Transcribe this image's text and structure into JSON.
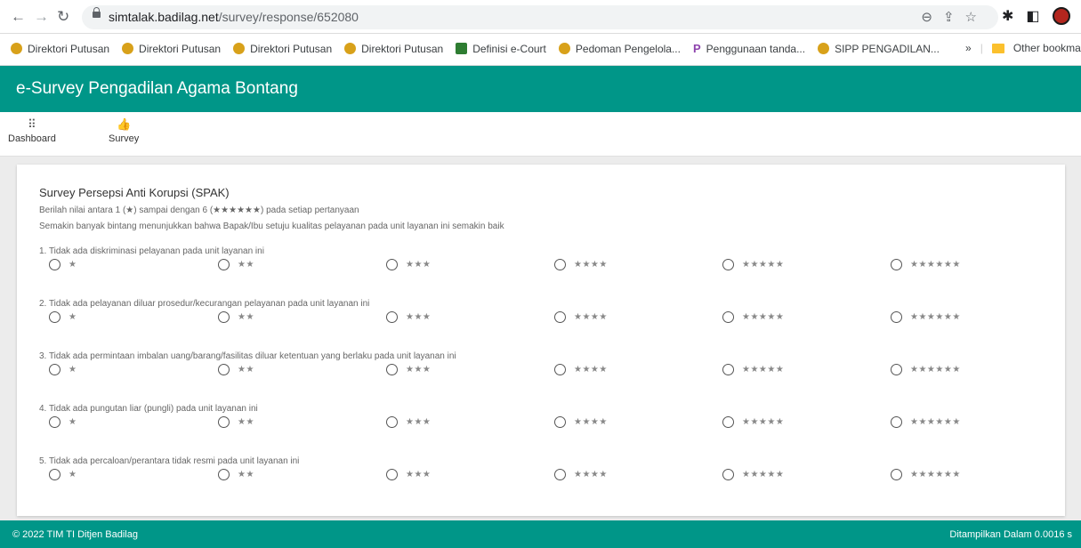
{
  "browser": {
    "url_host": "simtalak.badilag.net",
    "url_path": "/survey/response/652080",
    "bookmarks": [
      {
        "label": "Direktori Putusan",
        "icon": "coin-icon"
      },
      {
        "label": "Direktori Putusan",
        "icon": "coin-icon"
      },
      {
        "label": "Direktori Putusan",
        "icon": "coin-icon"
      },
      {
        "label": "Direktori Putusan",
        "icon": "coin-icon"
      },
      {
        "label": "Definisi e-Court",
        "icon": "court-icon"
      },
      {
        "label": "Pedoman Pengelola...",
        "icon": "coin-icon"
      },
      {
        "label": "Penggunaan tanda...",
        "icon": "p-icon"
      },
      {
        "label": "SIPP PENGADILAN...",
        "icon": "coin-icon"
      }
    ],
    "more_label": "»",
    "other_bookmarks": "Other bookmar"
  },
  "app": {
    "title": "e-Survey Pengadilan Agama Bontang",
    "tabs": [
      {
        "label": "Dashboard",
        "icon": "grid-icon"
      },
      {
        "label": "Survey",
        "icon": "thumbs-up-icon"
      }
    ]
  },
  "survey": {
    "title": "Survey Persepsi Anti Korupsi (SPAK)",
    "instruction1": "Berilah nilai antara 1 (★) sampai dengan 6 (★★★★★★) pada setiap pertanyaan",
    "instruction2": "Semakin banyak bintang menunjukkan bahwa Bapak/Ibu setuju kualitas pelayanan pada unit layanan ini semakin baik",
    "questions": [
      {
        "text": "1. Tidak ada diskriminasi pelayanan pada unit layanan ini"
      },
      {
        "text": "2. Tidak ada pelayanan diluar prosedur/kecurangan pelayanan pada unit layanan ini"
      },
      {
        "text": "3. Tidak ada permintaan imbalan uang/barang/fasilitas diluar ketentuan yang berlaku pada unit layanan ini"
      },
      {
        "text": "4. Tidak ada pungutan liar (pungli) pada unit layanan ini"
      },
      {
        "text": "5. Tidak ada percaloan/perantara tidak resmi pada unit layanan ini"
      }
    ],
    "options": [
      "★",
      "★★",
      "★★★",
      "★★★★",
      "★★★★★",
      "★★★★★★"
    ]
  },
  "footer": {
    "left": "© 2022 TIM TI Ditjen Badilag",
    "right": "Ditampilkan Dalam 0.0016 s"
  },
  "colors": {
    "primary": "#009688"
  }
}
